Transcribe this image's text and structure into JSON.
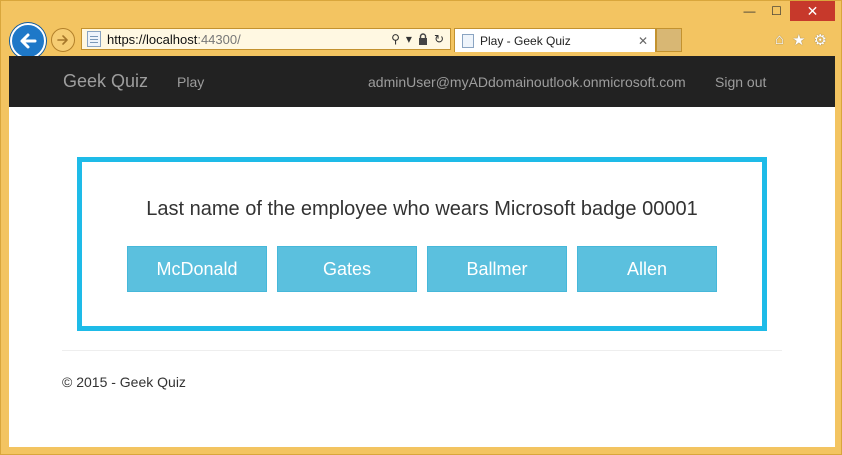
{
  "browser": {
    "url_host": "https://localhost",
    "url_port": ":44300/",
    "tab_title": "Play - Geek Quiz",
    "window_controls": {
      "minimize": "—",
      "maximize": "☐",
      "close": "✕"
    },
    "address_icons": {
      "search": "⚲",
      "dropdown": "▾",
      "lock": "🔒",
      "refresh": "↻"
    },
    "toolbar_icons": {
      "home": "⌂",
      "favorites": "★",
      "settings": "⚙"
    }
  },
  "navbar": {
    "brand": "Geek Quiz",
    "play": "Play",
    "user": "adminUser@myADdomainoutlook.onmicrosoft.com",
    "sign_out": "Sign out"
  },
  "quiz": {
    "question": "Last name of the employee who wears Microsoft badge 00001",
    "options": [
      "McDonald",
      "Gates",
      "Ballmer",
      "Allen"
    ]
  },
  "footer": {
    "copyright": "© 2015 - Geek Quiz"
  },
  "colors": {
    "accent": "#1ebbe8",
    "button": "#5bc0de",
    "navbar": "#222222",
    "frame": "#f3c461"
  }
}
